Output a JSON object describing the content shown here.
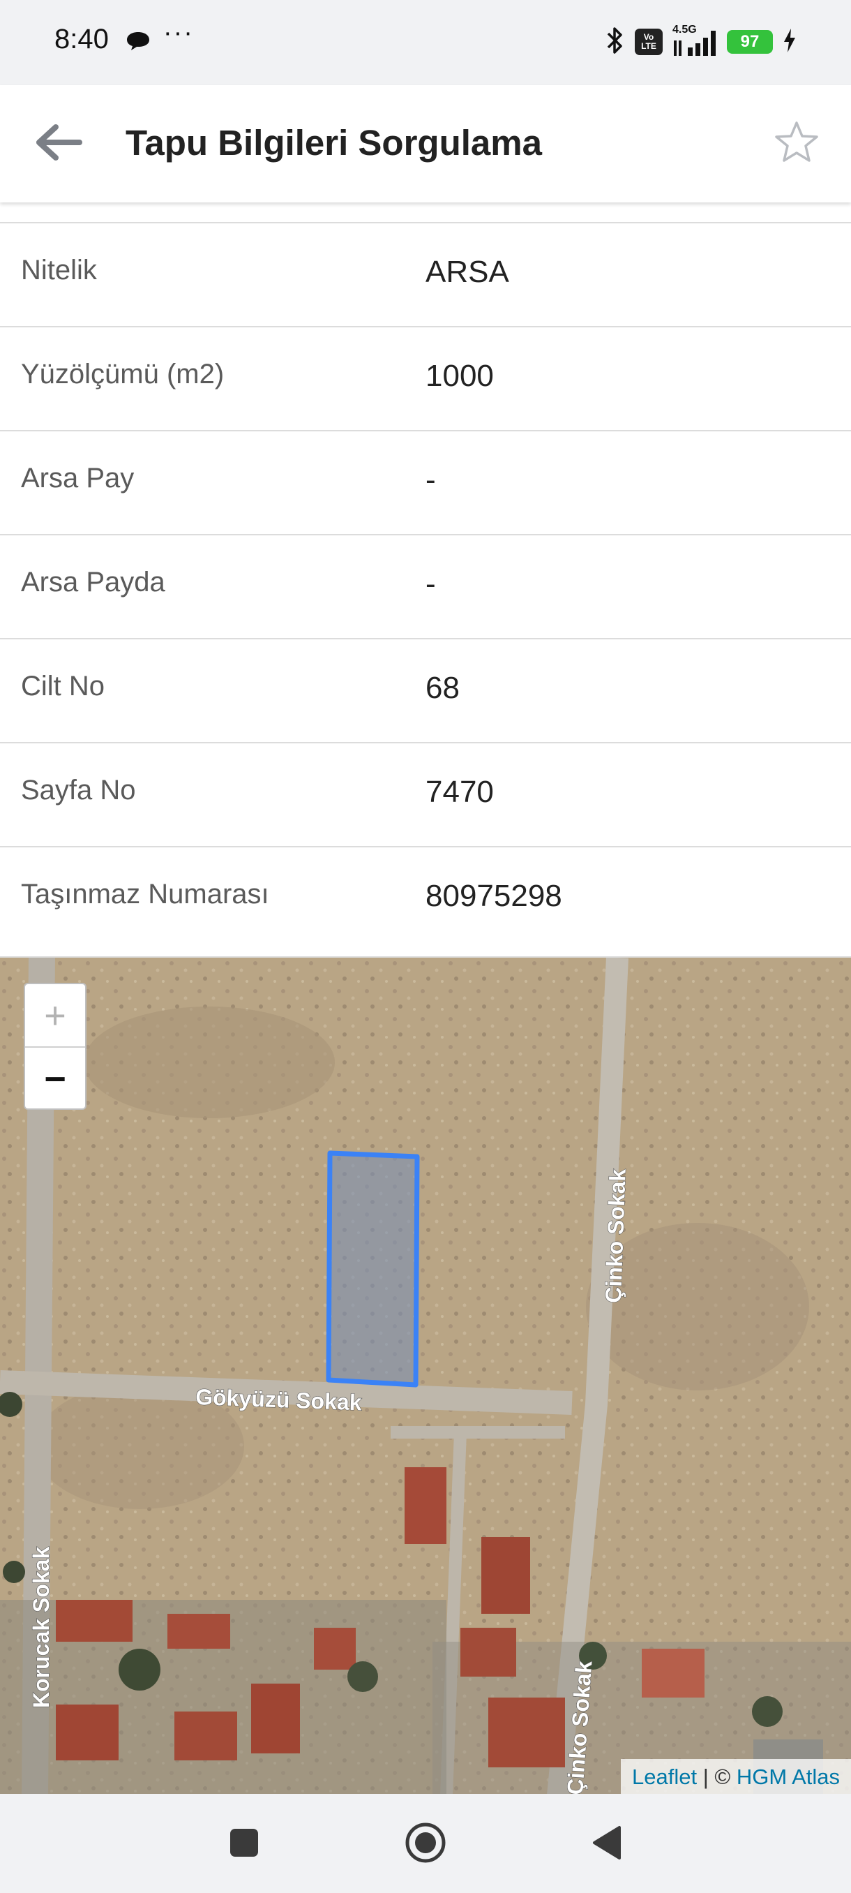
{
  "status_bar": {
    "time": "8:40",
    "overflow": "···",
    "volte_top": "Vo",
    "volte_bottom": "LTE",
    "network": "4.5G",
    "battery": "97",
    "icons": [
      "chat-bubble-icon",
      "bluetooth-icon",
      "signal-icon",
      "charging-icon"
    ]
  },
  "app_bar": {
    "title": "Tapu Bilgileri Sorgulama",
    "back_icon": "arrow-left-icon",
    "favorite_icon": "star-outline-icon"
  },
  "details": [
    {
      "label": "Nitelik",
      "value": "ARSA"
    },
    {
      "label": "Yüzölçümü (m2)",
      "value": "1000"
    },
    {
      "label": "Arsa Pay",
      "value": "-"
    },
    {
      "label": "Arsa Payda",
      "value": "-"
    },
    {
      "label": "Cilt No",
      "value": "68"
    },
    {
      "label": "Sayfa No",
      "value": "7470"
    },
    {
      "label": "Taşınmaz Numarası",
      "value": "80975298"
    }
  ],
  "map": {
    "zoom_in": "+",
    "zoom_out": "−",
    "streets": [
      "Gökyüzü Sokak",
      "Çinko Sokak",
      "Korucak Sokak",
      "Çinko Sokak"
    ],
    "attribution_leaflet": "Leaflet",
    "attribution_sep": " | © ",
    "attribution_provider": "HGM Atlas",
    "parcel_color": "#3b82f6"
  },
  "nav_bar": {
    "icons": [
      "recents-square-icon",
      "home-circle-icon",
      "back-triangle-icon"
    ]
  }
}
